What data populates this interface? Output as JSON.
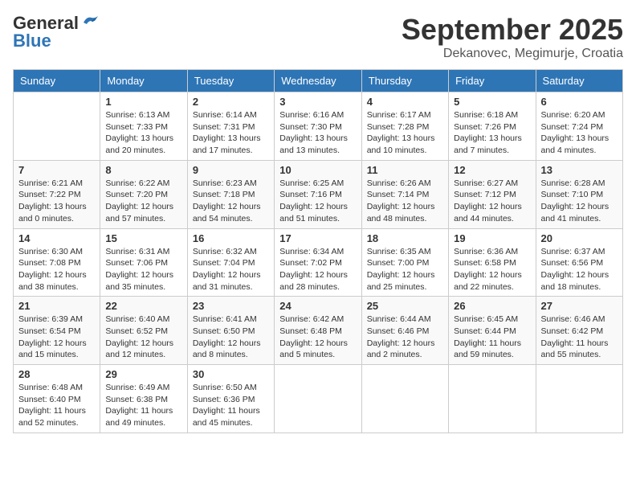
{
  "header": {
    "logo_general": "General",
    "logo_blue": "Blue",
    "month_year": "September 2025",
    "location": "Dekanovec, Megimurje, Croatia"
  },
  "weekdays": [
    "Sunday",
    "Monday",
    "Tuesday",
    "Wednesday",
    "Thursday",
    "Friday",
    "Saturday"
  ],
  "weeks": [
    [
      {
        "day": "",
        "info": ""
      },
      {
        "day": "1",
        "info": "Sunrise: 6:13 AM\nSunset: 7:33 PM\nDaylight: 13 hours\nand 20 minutes."
      },
      {
        "day": "2",
        "info": "Sunrise: 6:14 AM\nSunset: 7:31 PM\nDaylight: 13 hours\nand 17 minutes."
      },
      {
        "day": "3",
        "info": "Sunrise: 6:16 AM\nSunset: 7:30 PM\nDaylight: 13 hours\nand 13 minutes."
      },
      {
        "day": "4",
        "info": "Sunrise: 6:17 AM\nSunset: 7:28 PM\nDaylight: 13 hours\nand 10 minutes."
      },
      {
        "day": "5",
        "info": "Sunrise: 6:18 AM\nSunset: 7:26 PM\nDaylight: 13 hours\nand 7 minutes."
      },
      {
        "day": "6",
        "info": "Sunrise: 6:20 AM\nSunset: 7:24 PM\nDaylight: 13 hours\nand 4 minutes."
      }
    ],
    [
      {
        "day": "7",
        "info": "Sunrise: 6:21 AM\nSunset: 7:22 PM\nDaylight: 13 hours\nand 0 minutes."
      },
      {
        "day": "8",
        "info": "Sunrise: 6:22 AM\nSunset: 7:20 PM\nDaylight: 12 hours\nand 57 minutes."
      },
      {
        "day": "9",
        "info": "Sunrise: 6:23 AM\nSunset: 7:18 PM\nDaylight: 12 hours\nand 54 minutes."
      },
      {
        "day": "10",
        "info": "Sunrise: 6:25 AM\nSunset: 7:16 PM\nDaylight: 12 hours\nand 51 minutes."
      },
      {
        "day": "11",
        "info": "Sunrise: 6:26 AM\nSunset: 7:14 PM\nDaylight: 12 hours\nand 48 minutes."
      },
      {
        "day": "12",
        "info": "Sunrise: 6:27 AM\nSunset: 7:12 PM\nDaylight: 12 hours\nand 44 minutes."
      },
      {
        "day": "13",
        "info": "Sunrise: 6:28 AM\nSunset: 7:10 PM\nDaylight: 12 hours\nand 41 minutes."
      }
    ],
    [
      {
        "day": "14",
        "info": "Sunrise: 6:30 AM\nSunset: 7:08 PM\nDaylight: 12 hours\nand 38 minutes."
      },
      {
        "day": "15",
        "info": "Sunrise: 6:31 AM\nSunset: 7:06 PM\nDaylight: 12 hours\nand 35 minutes."
      },
      {
        "day": "16",
        "info": "Sunrise: 6:32 AM\nSunset: 7:04 PM\nDaylight: 12 hours\nand 31 minutes."
      },
      {
        "day": "17",
        "info": "Sunrise: 6:34 AM\nSunset: 7:02 PM\nDaylight: 12 hours\nand 28 minutes."
      },
      {
        "day": "18",
        "info": "Sunrise: 6:35 AM\nSunset: 7:00 PM\nDaylight: 12 hours\nand 25 minutes."
      },
      {
        "day": "19",
        "info": "Sunrise: 6:36 AM\nSunset: 6:58 PM\nDaylight: 12 hours\nand 22 minutes."
      },
      {
        "day": "20",
        "info": "Sunrise: 6:37 AM\nSunset: 6:56 PM\nDaylight: 12 hours\nand 18 minutes."
      }
    ],
    [
      {
        "day": "21",
        "info": "Sunrise: 6:39 AM\nSunset: 6:54 PM\nDaylight: 12 hours\nand 15 minutes."
      },
      {
        "day": "22",
        "info": "Sunrise: 6:40 AM\nSunset: 6:52 PM\nDaylight: 12 hours\nand 12 minutes."
      },
      {
        "day": "23",
        "info": "Sunrise: 6:41 AM\nSunset: 6:50 PM\nDaylight: 12 hours\nand 8 minutes."
      },
      {
        "day": "24",
        "info": "Sunrise: 6:42 AM\nSunset: 6:48 PM\nDaylight: 12 hours\nand 5 minutes."
      },
      {
        "day": "25",
        "info": "Sunrise: 6:44 AM\nSunset: 6:46 PM\nDaylight: 12 hours\nand 2 minutes."
      },
      {
        "day": "26",
        "info": "Sunrise: 6:45 AM\nSunset: 6:44 PM\nDaylight: 11 hours\nand 59 minutes."
      },
      {
        "day": "27",
        "info": "Sunrise: 6:46 AM\nSunset: 6:42 PM\nDaylight: 11 hours\nand 55 minutes."
      }
    ],
    [
      {
        "day": "28",
        "info": "Sunrise: 6:48 AM\nSunset: 6:40 PM\nDaylight: 11 hours\nand 52 minutes."
      },
      {
        "day": "29",
        "info": "Sunrise: 6:49 AM\nSunset: 6:38 PM\nDaylight: 11 hours\nand 49 minutes."
      },
      {
        "day": "30",
        "info": "Sunrise: 6:50 AM\nSunset: 6:36 PM\nDaylight: 11 hours\nand 45 minutes."
      },
      {
        "day": "",
        "info": ""
      },
      {
        "day": "",
        "info": ""
      },
      {
        "day": "",
        "info": ""
      },
      {
        "day": "",
        "info": ""
      }
    ]
  ]
}
